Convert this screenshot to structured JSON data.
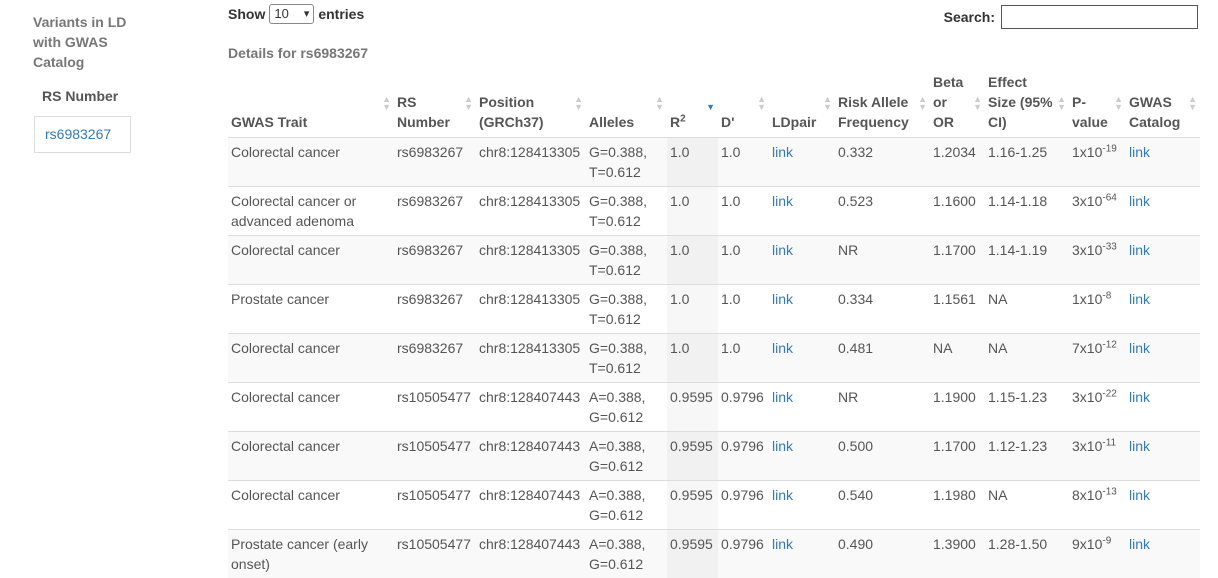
{
  "sidebar": {
    "title": "Variants in LD with GWAS Catalog",
    "column_header": "RS Number",
    "rs_number": "rs6983267"
  },
  "controls": {
    "show_label": "Show",
    "entries_value": "10",
    "entries_label": "entries",
    "search_label": "Search:"
  },
  "details_title": "Details for rs6983267",
  "table": {
    "headers": {
      "trait": "GWAS Trait",
      "rs": "RS Number",
      "position": "Position (GRCh37)",
      "alleles": "Alleles",
      "r2_base": "R",
      "r2_sup": "2",
      "dprime": "D'",
      "ldpair": "LDpair",
      "raf": "Risk Allele Frequency",
      "beta": "Beta or OR",
      "effect": "Effect Size (95% CI)",
      "pvalue": "P-value",
      "catalog": "GWAS Catalog"
    },
    "rows": [
      {
        "trait": "Colorectal cancer",
        "rs": "rs6983267",
        "position": "chr8:128413305",
        "allele1": "G=0.388,",
        "allele2": "T=0.612",
        "r2": "1.0",
        "dprime": "1.0",
        "ldpair": "link",
        "raf": "0.332",
        "beta": "1.2034",
        "effect": "1.16-1.25",
        "p_base": "1x10",
        "p_exp": "-19",
        "catalog": "link"
      },
      {
        "trait": "Colorectal cancer or advanced adenoma",
        "rs": "rs6983267",
        "position": "chr8:128413305",
        "allele1": "G=0.388,",
        "allele2": "T=0.612",
        "r2": "1.0",
        "dprime": "1.0",
        "ldpair": "link",
        "raf": "0.523",
        "beta": "1.1600",
        "effect": "1.14-1.18",
        "p_base": "3x10",
        "p_exp": "-64",
        "catalog": "link"
      },
      {
        "trait": "Colorectal cancer",
        "rs": "rs6983267",
        "position": "chr8:128413305",
        "allele1": "G=0.388,",
        "allele2": "T=0.612",
        "r2": "1.0",
        "dprime": "1.0",
        "ldpair": "link",
        "raf": "NR",
        "beta": "1.1700",
        "effect": "1.14-1.19",
        "p_base": "3x10",
        "p_exp": "-33",
        "catalog": "link"
      },
      {
        "trait": "Prostate cancer",
        "rs": "rs6983267",
        "position": "chr8:128413305",
        "allele1": "G=0.388,",
        "allele2": "T=0.612",
        "r2": "1.0",
        "dprime": "1.0",
        "ldpair": "link",
        "raf": "0.334",
        "beta": "1.1561",
        "effect": "NA",
        "p_base": "1x10",
        "p_exp": "-8",
        "catalog": "link"
      },
      {
        "trait": "Colorectal cancer",
        "rs": "rs6983267",
        "position": "chr8:128413305",
        "allele1": "G=0.388,",
        "allele2": "T=0.612",
        "r2": "1.0",
        "dprime": "1.0",
        "ldpair": "link",
        "raf": "0.481",
        "beta": "NA",
        "effect": "NA",
        "p_base": "7x10",
        "p_exp": "-12",
        "catalog": "link"
      },
      {
        "trait": "Colorectal cancer",
        "rs": "rs10505477",
        "position": "chr8:128407443",
        "allele1": "A=0.388,",
        "allele2": "G=0.612",
        "r2": "0.9595",
        "dprime": "0.9796",
        "ldpair": "link",
        "raf": "NR",
        "beta": "1.1900",
        "effect": "1.15-1.23",
        "p_base": "3x10",
        "p_exp": "-22",
        "catalog": "link"
      },
      {
        "trait": "Colorectal cancer",
        "rs": "rs10505477",
        "position": "chr8:128407443",
        "allele1": "A=0.388,",
        "allele2": "G=0.612",
        "r2": "0.9595",
        "dprime": "0.9796",
        "ldpair": "link",
        "raf": "0.500",
        "beta": "1.1700",
        "effect": "1.12-1.23",
        "p_base": "3x10",
        "p_exp": "-11",
        "catalog": "link"
      },
      {
        "trait": "Colorectal cancer",
        "rs": "rs10505477",
        "position": "chr8:128407443",
        "allele1": "A=0.388,",
        "allele2": "G=0.612",
        "r2": "0.9595",
        "dprime": "0.9796",
        "ldpair": "link",
        "raf": "0.540",
        "beta": "1.1980",
        "effect": "NA",
        "p_base": "8x10",
        "p_exp": "-13",
        "catalog": "link"
      },
      {
        "trait": "Prostate cancer (early onset)",
        "rs": "rs10505477",
        "position": "chr8:128407443",
        "allele1": "A=0.388,",
        "allele2": "G=0.612",
        "r2": "0.9595",
        "dprime": "0.9796",
        "ldpair": "link",
        "raf": "0.490",
        "beta": "1.3900",
        "effect": "1.28-1.50",
        "p_base": "9x10",
        "p_exp": "-9",
        "catalog": "link"
      }
    ]
  }
}
